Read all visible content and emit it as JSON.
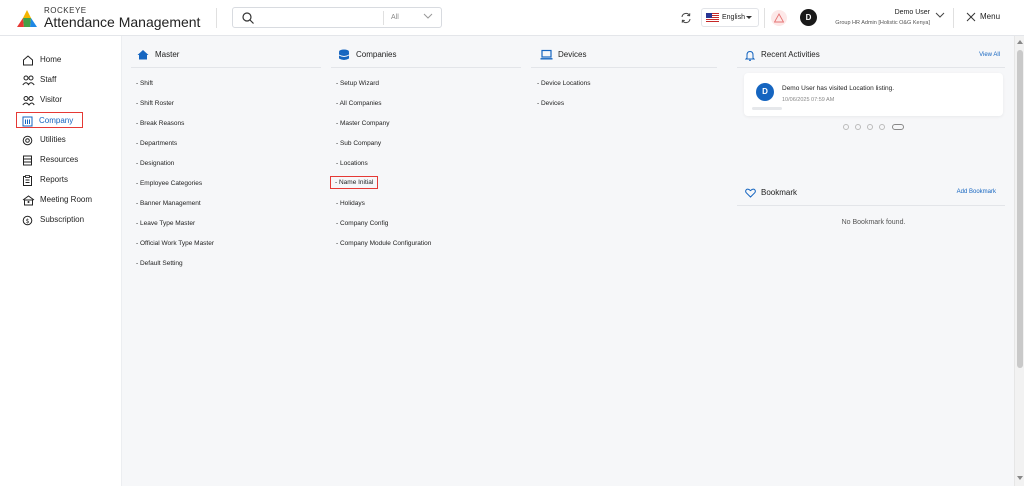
{
  "header": {
    "brand_small": "ROCKEYE",
    "brand_title": "Attendance Management",
    "search_placeholder": "",
    "search_scope": "All",
    "language": "English",
    "user_initial": "D",
    "user_name": "Demo User",
    "user_role": "Group HR Admin [Holistic O&G Kenya]",
    "menu_label": "Menu"
  },
  "sidebar": {
    "items": [
      {
        "label": "Home",
        "icon": "home-icon"
      },
      {
        "label": "Staff",
        "icon": "staff-icon"
      },
      {
        "label": "Visitor",
        "icon": "visitor-icon"
      },
      {
        "label": "Company",
        "icon": "company-icon",
        "active": true
      },
      {
        "label": "Utilities",
        "icon": "utilities-icon"
      },
      {
        "label": "Resources",
        "icon": "resources-icon"
      },
      {
        "label": "Reports",
        "icon": "reports-icon"
      },
      {
        "label": "Meeting Room",
        "icon": "meeting-room-icon"
      },
      {
        "label": "Subscription",
        "icon": "subscription-icon"
      }
    ]
  },
  "master": {
    "title": "Master",
    "links": [
      "- Shift",
      "- Shift Roster",
      "- Break Reasons",
      "- Departments",
      "- Designation",
      "- Employee Categories",
      "- Banner Management",
      "- Leave Type Master",
      "- Official Work Type Master",
      "- Default Setting"
    ]
  },
  "companies": {
    "title": "Companies",
    "links": [
      "- Setup Wizard",
      "- All Companies",
      "- Master Company",
      "- Sub Company",
      "- Locations",
      "- Name Initial",
      "- Holidays",
      "- Company Config",
      "- Company Module Configuration"
    ]
  },
  "devices": {
    "title": "Devices",
    "links": [
      "- Device Locations",
      "- Devices"
    ]
  },
  "recent": {
    "title": "Recent Activities",
    "view_all": "View All",
    "activity": {
      "initial": "D",
      "text": "Demo User has visited Location listing.",
      "time": "10/06/2025 07:59 AM"
    }
  },
  "bookmark": {
    "title": "Bookmark",
    "add_label": "Add Bookmark",
    "empty_text": "No Bookmark found."
  },
  "colors": {
    "accent": "#1565c0",
    "highlight_border": "#e53935"
  }
}
